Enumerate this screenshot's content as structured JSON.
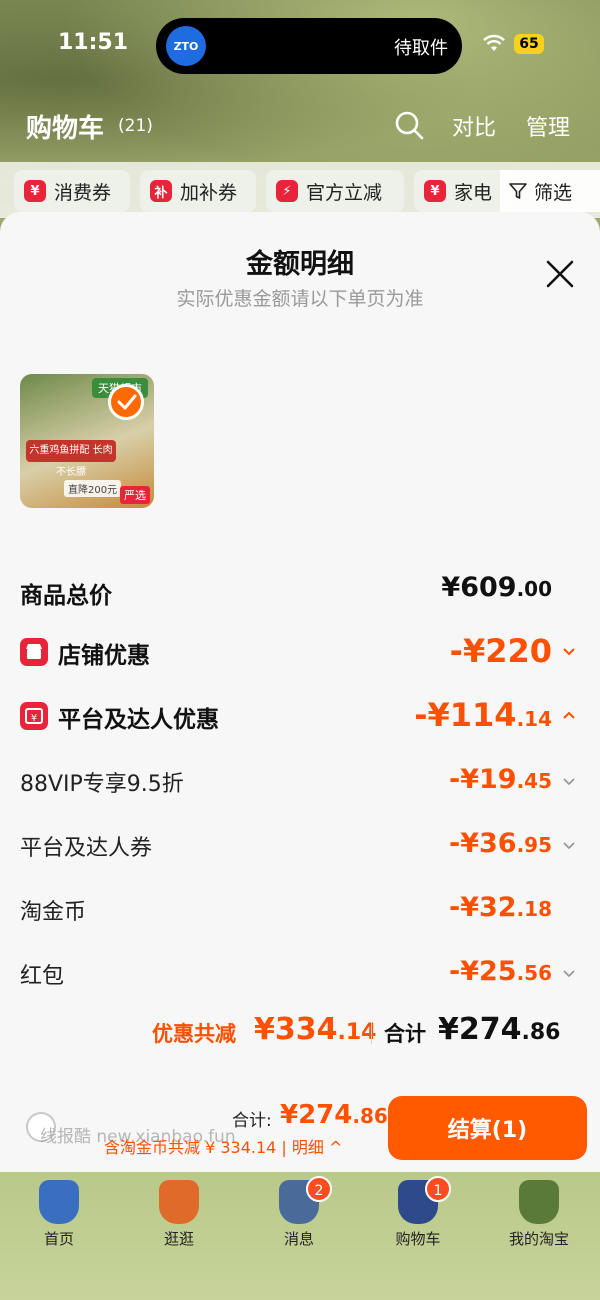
{
  "status_bar": {
    "time": "11:51",
    "island_logo": "ZTO",
    "island_text": "待取件",
    "battery": "65"
  },
  "header": {
    "title": "购物车",
    "count": "(21)",
    "compare": "对比",
    "manage": "管理"
  },
  "chips": [
    {
      "icon": "¥",
      "label": "消费券"
    },
    {
      "icon": "补",
      "label": "加补券"
    },
    {
      "icon": "⚡",
      "label": "官方立减"
    },
    {
      "icon": "¥",
      "label": "家电"
    }
  ],
  "filter": "筛选",
  "sheet": {
    "title": "金额明细",
    "subtitle": "实际优惠金额请以下单页为准",
    "product": {
      "store_tag": "天猫超市",
      "banner": "六重鸡鱼拼配 长肉不长膘",
      "price_tag": "直降200元",
      "badge": "严选"
    },
    "rows": {
      "total_price": {
        "label": "商品总价",
        "int": "¥609",
        "dec": ".00"
      },
      "store_discount": {
        "label": "店铺优惠",
        "int": "-¥220",
        "dec": ""
      },
      "platform_discount": {
        "label": "平台及达人优惠",
        "int": "-¥114",
        "dec": ".14"
      },
      "vip": {
        "label": "88VIP专享9.5折",
        "int": "-¥19",
        "dec": ".45"
      },
      "coupon": {
        "label": "平台及达人券",
        "int": "-¥36",
        "dec": ".95"
      },
      "coins": {
        "label": "淘金币",
        "int": "-¥32",
        "dec": ".18"
      },
      "red_packet": {
        "label": "红包",
        "int": "-¥25",
        "dec": ".56"
      }
    },
    "summary": {
      "discount_label": "优惠共减",
      "discount_int": "¥334",
      "discount_dec": ".14",
      "total_label": "合计",
      "total_int": "¥274",
      "total_dec": ".86"
    }
  },
  "checkout": {
    "watermark": "线报酷 new.xianbao.fun",
    "total_label": "合计:",
    "total_int": "¥274",
    "total_dec": ".86",
    "detail": "含淘金币共减 ¥ 334.14 | 明细 ^",
    "button": "结算(1)"
  },
  "tabs": [
    {
      "label": "首页",
      "color": "#3a6fbf",
      "badge": ""
    },
    {
      "label": "逛逛",
      "color": "#e06a2a",
      "badge": ""
    },
    {
      "label": "消息",
      "color": "#4a6a9a",
      "badge": "2"
    },
    {
      "label": "购物车",
      "color": "#2e4a8a",
      "badge": "1"
    },
    {
      "label": "我的淘宝",
      "color": "#5a7a3a",
      "badge": ""
    }
  ],
  "colors": {
    "accent": "#ff5000",
    "checkout_button": "#ff5a00",
    "discount_icon": "#e8243a"
  }
}
